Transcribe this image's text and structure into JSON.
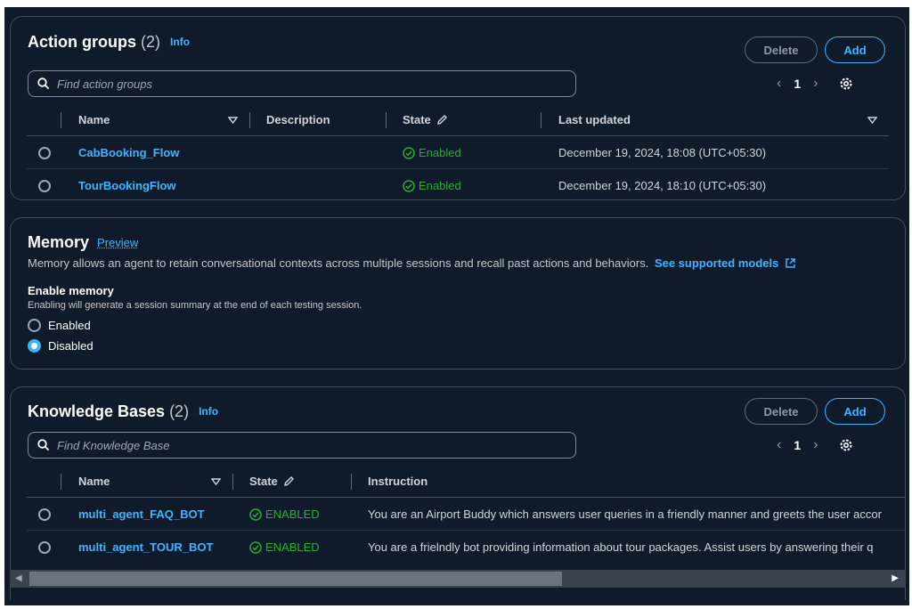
{
  "action_groups": {
    "title": "Action groups",
    "count": "(2)",
    "info": "Info",
    "delete_label": "Delete",
    "add_label": "Add",
    "search_placeholder": "Find action groups",
    "page": "1",
    "columns": {
      "name": "Name",
      "description": "Description",
      "state": "State",
      "last_updated": "Last updated"
    },
    "rows": [
      {
        "name": "CabBooking_Flow",
        "description": "",
        "state": "Enabled",
        "last_updated": "December 19, 2024, 18:08 (UTC+05:30)"
      },
      {
        "name": "TourBookingFlow",
        "description": "",
        "state": "Enabled",
        "last_updated": "December 19, 2024, 18:10 (UTC+05:30)"
      }
    ]
  },
  "memory": {
    "title": "Memory",
    "preview": "Preview",
    "description": "Memory allows an agent to retain conversational contexts across multiple sessions and recall past actions and behaviors.",
    "link": "See supported models",
    "enable_label": "Enable memory",
    "enable_hint": "Enabling will generate a session summary at the end of each testing session.",
    "options": [
      "Enabled",
      "Disabled"
    ],
    "selected": "Disabled"
  },
  "knowledge_bases": {
    "title": "Knowledge Bases",
    "count": "(2)",
    "info": "Info",
    "delete_label": "Delete",
    "add_label": "Add",
    "search_placeholder": "Find Knowledge Base",
    "page": "1",
    "columns": {
      "name": "Name",
      "state": "State",
      "instruction": "Instruction"
    },
    "rows": [
      {
        "name": "multi_agent_FAQ_BOT",
        "state": "ENABLED",
        "instruction": "You are an Airport Buddy which answers user queries in a friendly manner and greets the user accor"
      },
      {
        "name": "multi_agent_TOUR_BOT",
        "state": "ENABLED",
        "instruction": "You are a frielndly bot providing information about tour packages. Assist users by answering their q"
      }
    ]
  },
  "colors": {
    "background": "#0f1b2a",
    "accent": "#42b4ff",
    "success": "#29ad32",
    "border": "#414d5c"
  },
  "icons": [
    "search-icon",
    "chevron-left-icon",
    "chevron-right-icon",
    "gear-icon",
    "sort-caret-icon",
    "pencil-icon",
    "check-circle-icon",
    "external-link-icon"
  ]
}
